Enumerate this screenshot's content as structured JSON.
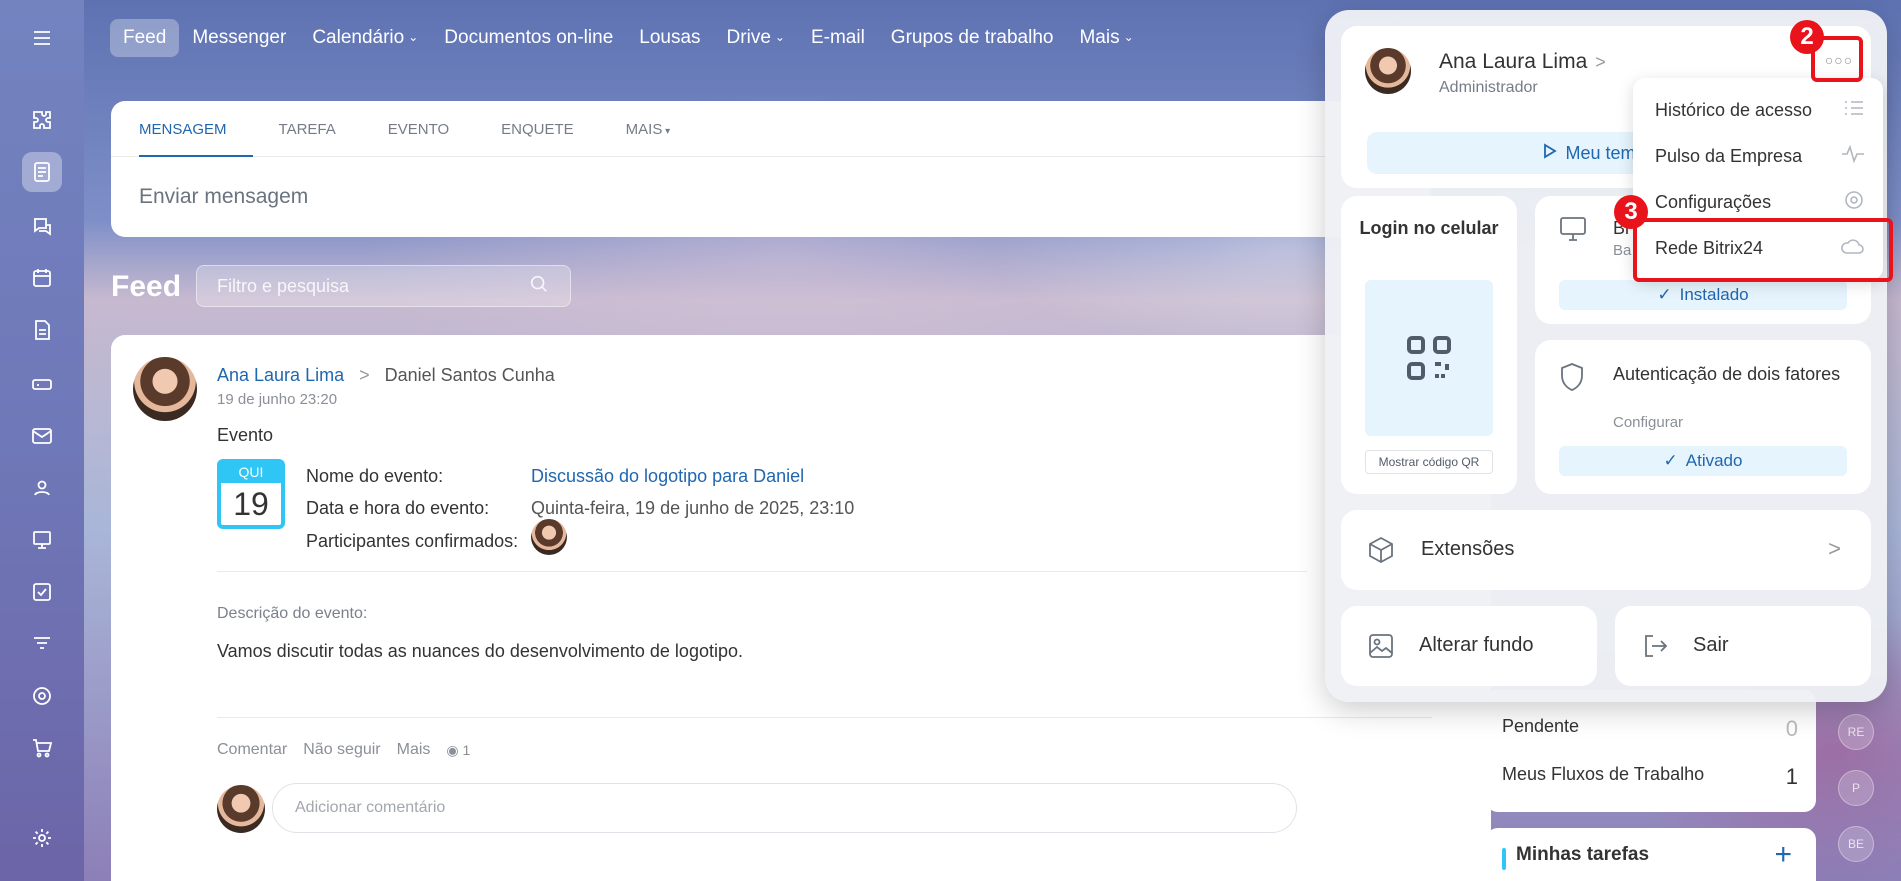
{
  "topnav": {
    "items": [
      {
        "label": "Feed",
        "active": true,
        "has_chevron": false
      },
      {
        "label": "Messenger",
        "has_chevron": false
      },
      {
        "label": "Calendário",
        "has_chevron": true
      },
      {
        "label": "Documentos on-line",
        "has_chevron": false
      },
      {
        "label": "Lousas",
        "has_chevron": false
      },
      {
        "label": "Drive",
        "has_chevron": true
      },
      {
        "label": "E-mail",
        "has_chevron": false
      },
      {
        "label": "Grupos de trabalho",
        "has_chevron": false
      },
      {
        "label": "Mais",
        "has_chevron": true
      }
    ]
  },
  "sidebar": {
    "icons": [
      "menu-icon",
      "puzzle-icon",
      "feed-icon",
      "chat-icon",
      "calendar-icon",
      "document-icon",
      "drive-icon",
      "mail-icon",
      "groups-icon",
      "boards-icon",
      "tasks-icon",
      "filter-icon",
      "target-icon",
      "cart-icon",
      "settings-icon"
    ]
  },
  "composer": {
    "tabs": [
      "Mensagem",
      "Tarefa",
      "Evento",
      "Enquete",
      "Mais"
    ],
    "placeholder": "Enviar mensagem"
  },
  "feed": {
    "title": "Feed",
    "filter_placeholder": "Filtro e pesquisa"
  },
  "post": {
    "author": "Ana Laura Lima",
    "recipient": "Daniel Santos Cunha",
    "date": "19 de junho 23:20",
    "type_label": "Evento",
    "calendar": {
      "month": "QUI",
      "day": "19"
    },
    "event_name_label": "Nome do evento:",
    "event_name": "Discussão do logotipo para Daniel",
    "event_datetime_label": "Data e hora do evento:",
    "event_datetime": "Quinta-feira, 19 de junho de 2025, 23:10",
    "participants_label": "Participantes confirmados:",
    "description_label": "Descrição do evento:",
    "description": "Vamos discutir todas as nuances do desenvolvimento de logotipo.",
    "actions": {
      "comment": "Comentar",
      "unfollow": "Não seguir",
      "more": "Mais",
      "views": "1"
    },
    "comment_placeholder": "Adicionar comentário"
  },
  "right_widgets": {
    "counters": [
      {
        "label": "Pendente",
        "value": "0"
      },
      {
        "label": "Meus Fluxos de Trabalho",
        "value": "1"
      }
    ],
    "tasks_title": "Minhas tarefas",
    "tasks_add": "+",
    "mini_avatars": [
      "RE",
      "P",
      "BE"
    ]
  },
  "profile_popup": {
    "name": "Ana Laura Lima",
    "role": "Administrador",
    "time_button": "Meu tempo ho",
    "qr_title": "Login no celular",
    "qr_button": "Mostrar código QR",
    "desktop_title": "Bi",
    "desktop_sub": "Ba",
    "desktop_status": "Instalado",
    "twofa_title": "Autenticação de dois fatores",
    "twofa_sub": "Configurar",
    "twofa_status": "Ativado",
    "extensions": "Extensões",
    "change_background": "Alterar fundo",
    "logout": "Sair"
  },
  "dropdown_menu": {
    "items": [
      {
        "label": "Histórico de acesso",
        "icon": "list-icon"
      },
      {
        "label": "Pulso da Empresa",
        "icon": "pulse-icon"
      },
      {
        "label": "Configurações",
        "icon": "gear-icon"
      },
      {
        "label": "Rede Bitrix24",
        "icon": "cloud-icon"
      }
    ]
  },
  "annotations": {
    "step2": "2",
    "step3": "3",
    "color": "#e8131b"
  }
}
